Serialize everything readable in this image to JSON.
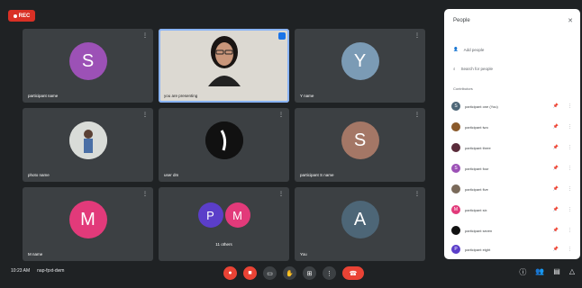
{
  "recording_badge": "REC",
  "tiles": [
    {
      "name": "participant name",
      "initial": "S",
      "avatar_color": "#9c51b6",
      "kind": "initial"
    },
    {
      "name": "you are presenting",
      "initial": "",
      "avatar_color": "#dcd9d2",
      "kind": "webcam"
    },
    {
      "name": "Y name",
      "initial": "Y",
      "avatar_color": "#7b9bb5",
      "kind": "initial"
    },
    {
      "name": "photo name",
      "initial": "",
      "avatar_color": "#cfd2d4",
      "kind": "photo"
    },
    {
      "name": "user dm",
      "initial": "",
      "avatar_color": "#111111",
      "kind": "logo"
    },
    {
      "name": "participant S name",
      "initial": "S",
      "avatar_color": "#a47766",
      "kind": "initial"
    },
    {
      "name": "M name",
      "initial": "M",
      "avatar_color": "#e23a7a",
      "kind": "initial"
    },
    {
      "name": "11 others",
      "initial": "",
      "avatar_color": "#3c4043",
      "kind": "group",
      "group": [
        "P",
        "M"
      ]
    },
    {
      "name": "You",
      "initial": "A",
      "avatar_color": "#4d6677",
      "kind": "initial"
    }
  ],
  "bottom_bar": {
    "time": "10:23 AM",
    "meeting_code": "nap-fpxt-dwm"
  },
  "controls": [
    {
      "name": "mic-button",
      "glyph": "🎤",
      "color": "#ea4335"
    },
    {
      "name": "camera-button",
      "glyph": "■",
      "color": "#ea4335"
    },
    {
      "name": "captions-button",
      "glyph": "▭",
      "color": "#3c4043"
    },
    {
      "name": "raise-hand-button",
      "glyph": "✋",
      "color": "#3c4043"
    },
    {
      "name": "present-button",
      "glyph": "⊞",
      "color": "#3c4043"
    },
    {
      "name": "more-button",
      "glyph": "⋮",
      "color": "#3c4043"
    }
  ],
  "panel": {
    "title": "People",
    "add_people": "Add people",
    "search_placeholder": "Search for people",
    "section_label": "Contributors",
    "people": [
      {
        "name": "participant one (You)",
        "initial": "S",
        "color": "#4d6677"
      },
      {
        "name": "participant two",
        "initial": "",
        "color": "#8a5a2b"
      },
      {
        "name": "participant three",
        "initial": "",
        "color": "#5a2b3a"
      },
      {
        "name": "participant four",
        "initial": "S",
        "color": "#9c51b6"
      },
      {
        "name": "participant five",
        "initial": "",
        "color": "#7a6a5a"
      },
      {
        "name": "participant six",
        "initial": "M",
        "color": "#e23a7a"
      },
      {
        "name": "participant seven",
        "initial": "",
        "color": "#111111"
      },
      {
        "name": "participant eight",
        "initial": "P",
        "color": "#5b3ec9"
      }
    ]
  }
}
